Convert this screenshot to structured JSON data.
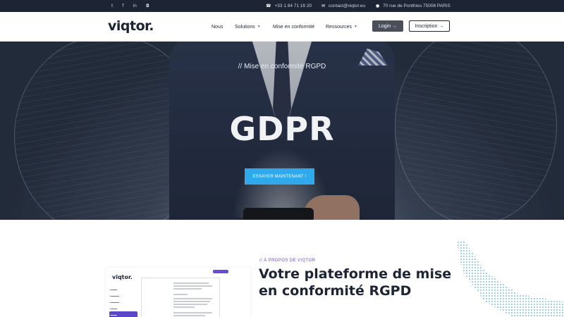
{
  "topbar": {
    "social": [
      {
        "icon": "twitter-icon",
        "glyph": "t"
      },
      {
        "icon": "facebook-icon",
        "glyph": "f"
      },
      {
        "icon": "linkedin-icon",
        "glyph": "in"
      },
      {
        "icon": "instagram-icon",
        "glyph": "◘"
      }
    ],
    "phone": "+33 1 84 71 16 20",
    "email": "contact@viqtor.eu",
    "address": "70 rue de Ponthieu 75008 PARIS"
  },
  "nav": {
    "logo": "viqtor.",
    "items": [
      {
        "label": "Nous",
        "dropdown": false
      },
      {
        "label": "Solutions",
        "dropdown": true
      },
      {
        "label": "Mise en conformité",
        "dropdown": false
      },
      {
        "label": "Ressources",
        "dropdown": true
      }
    ],
    "login": "Login →",
    "signup": "Inscription →"
  },
  "hero": {
    "subtitle": "// Mise en conformité RGPD",
    "title": "GDPR",
    "cta": "ESSAYER MAINTENANT !"
  },
  "about": {
    "kicker": "// À PROPOS DE VIQTOR",
    "title": "Votre plateforme de mise en conformité RGPD",
    "mock_logo": "viqtor."
  },
  "colors": {
    "topbar": "#1d2433",
    "cta": "#2fa9ec",
    "accent": "#6b4bd6",
    "login_bg": "#4a4f59"
  }
}
